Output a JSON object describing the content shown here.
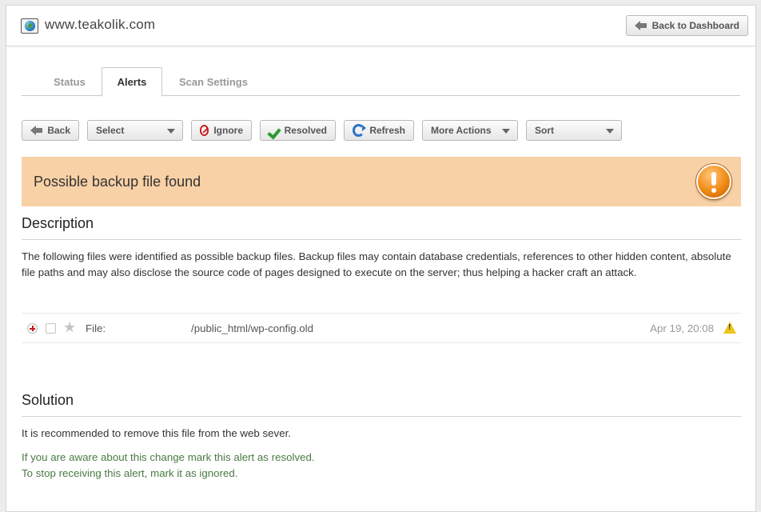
{
  "header": {
    "site_name": "www.teakolik.com",
    "back_to_dashboard": "Back to Dashboard"
  },
  "tabs": [
    {
      "label": "Status",
      "active": false
    },
    {
      "label": "Alerts",
      "active": true
    },
    {
      "label": "Scan Settings",
      "active": false
    }
  ],
  "toolbar": {
    "back": "Back",
    "select": "Select",
    "ignore": "Ignore",
    "resolved": "Resolved",
    "refresh": "Refresh",
    "more_actions": "More Actions",
    "sort": "Sort"
  },
  "alert": {
    "title": "Possible backup file found",
    "banner_color": "#f9d1a6",
    "icon": "warning-circle-icon"
  },
  "description": {
    "heading": "Description",
    "text": "The following files were identified as possible backup files. Backup files may contain database credentials, references to other hidden content, absolute file paths and may also disclose the source code of pages designed to execute on the server; thus helping a hacker craft an attack."
  },
  "file": {
    "label": "File:",
    "path": "/public_html/wp-config.old",
    "date": "Apr 19, 20:08"
  },
  "solution": {
    "heading": "Solution",
    "text": "It is recommended to remove this file from the web sever.",
    "hint_line1": "If you are aware about this change mark this alert as resolved.",
    "hint_line2": "To stop receiving this alert, mark it as ignored.",
    "hint_color": "#4b7a44"
  }
}
